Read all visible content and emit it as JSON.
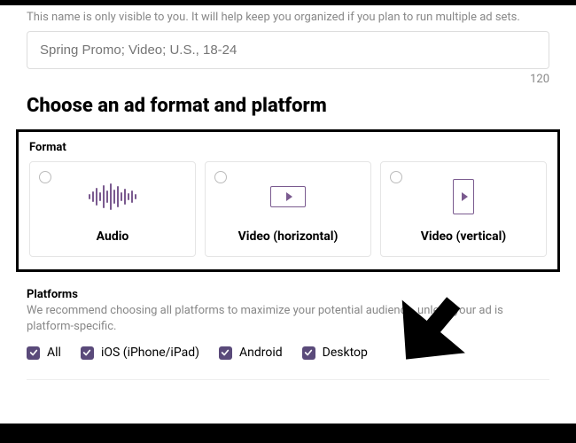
{
  "helper_text": "This name is only visible to you. It will help keep you organized if you plan to run multiple ad sets.",
  "name_input": {
    "placeholder": "Spring Promo; Video; U.S., 18-24"
  },
  "char_count": "120",
  "section_title": "Choose an ad format and platform",
  "format": {
    "label": "Format",
    "options": [
      {
        "label": "Audio"
      },
      {
        "label": "Video (horizontal)"
      },
      {
        "label": "Video (vertical)"
      }
    ]
  },
  "platforms": {
    "label": "Platforms",
    "help": "We recommend choosing all platforms to maximize your potential audience, unless your ad is platform-specific.",
    "items": [
      {
        "label": "All"
      },
      {
        "label": "iOS (iPhone/iPad)"
      },
      {
        "label": "Android"
      },
      {
        "label": "Desktop"
      }
    ]
  }
}
